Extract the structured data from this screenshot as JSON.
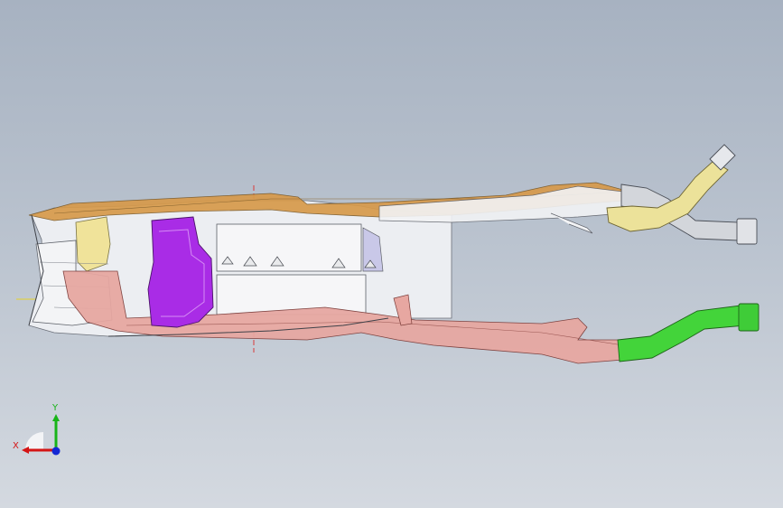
{
  "triad": {
    "x_label": "X",
    "y_label": "Y",
    "x_color": "#d41414",
    "y_color": "#18b418",
    "z_color": "#1428d4"
  },
  "parts": [
    {
      "id": "housing",
      "color": "#eceef2"
    },
    {
      "id": "top-panel",
      "color": "#d79a4a"
    },
    {
      "id": "front-yellow",
      "color": "#f0e39a"
    },
    {
      "id": "lower-pink",
      "color": "#e7a7a1"
    },
    {
      "id": "purple-duct",
      "color": "#a92ce6"
    },
    {
      "id": "gray-tube",
      "color": "#d3d6db"
    },
    {
      "id": "yellow-tube",
      "color": "#ece29a"
    },
    {
      "id": "green-tube",
      "color": "#43d43a"
    }
  ]
}
